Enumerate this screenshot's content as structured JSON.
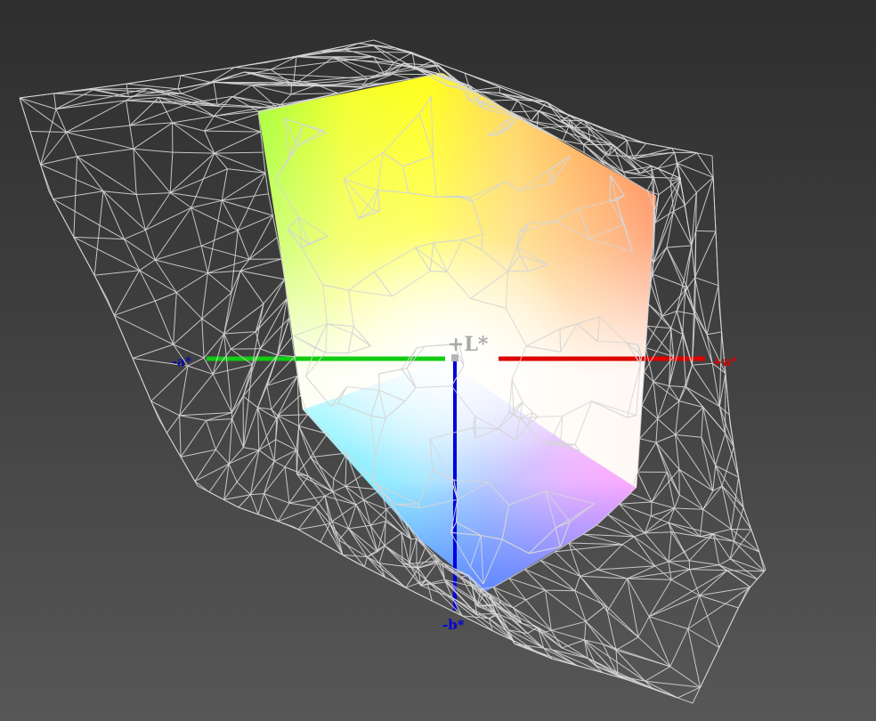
{
  "axes": {
    "l_plus": "+L*",
    "a_plus": "+a*",
    "a_minus": "-a*",
    "b_minus": "-b*"
  },
  "colors": {
    "background_top": "#2e2e2e",
    "background_bottom": "#575757",
    "wireframe": "#d6d6d6",
    "a_plus_axis": "#dd0000",
    "a_minus_axis": "#11cc11",
    "b_minus_axis": "#0000dd",
    "l_label": "#a8a8a8"
  }
}
